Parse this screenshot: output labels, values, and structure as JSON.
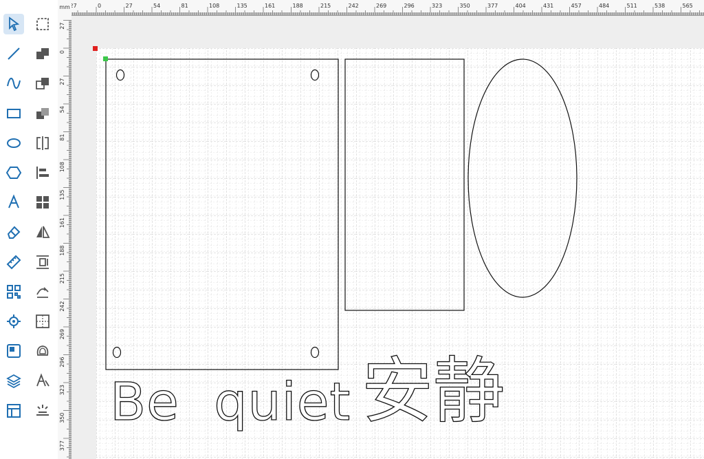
{
  "app": {
    "unit": "mm",
    "accent_color": "#1f6fb2",
    "handle_red": "#e0201e",
    "handle_green": "#3cc84a"
  },
  "tools_left": [
    {
      "name": "select-tool-icon",
      "active": true
    },
    {
      "name": "line-tool-icon"
    },
    {
      "name": "curve-tool-icon"
    },
    {
      "name": "rectangle-tool-icon"
    },
    {
      "name": "ellipse-tool-icon"
    },
    {
      "name": "polygon-tool-icon"
    },
    {
      "name": "text-tool-icon"
    },
    {
      "name": "eraser-tool-icon"
    },
    {
      "name": "ruler-tool-icon"
    },
    {
      "name": "qr-code-tool-icon"
    },
    {
      "name": "position-tool-icon"
    },
    {
      "name": "image-tool-icon"
    },
    {
      "name": "layers-tool-icon"
    },
    {
      "name": "layout-tool-icon"
    }
  ],
  "tools_right": [
    {
      "name": "rounded-corner-icon"
    },
    {
      "name": "union-icon"
    },
    {
      "name": "subtract-icon"
    },
    {
      "name": "intersect-icon"
    },
    {
      "name": "split-icon"
    },
    {
      "name": "align-icon"
    },
    {
      "name": "distribute-icon"
    },
    {
      "name": "mirror-icon"
    },
    {
      "name": "size-icon"
    },
    {
      "name": "edit-path-icon"
    },
    {
      "name": "array-icon"
    },
    {
      "name": "offset-icon"
    },
    {
      "name": "vectorize-icon"
    },
    {
      "name": "effects-icon"
    }
  ],
  "ruler_top_labels": [
    "27",
    "0",
    "27",
    "54",
    "81",
    "108",
    "135",
    "161",
    "188",
    "215",
    "242",
    "269",
    "296",
    "323",
    "350",
    "377",
    "404",
    "431",
    "457",
    "484",
    "511",
    "538",
    "565"
  ],
  "ruler_left_labels": [
    "27",
    "0",
    "27",
    "54",
    "81",
    "108",
    "135",
    "161",
    "188",
    "215",
    "242",
    "269",
    "296",
    "323",
    "350",
    "377"
  ],
  "canvas_text": {
    "english": "Be  quiet",
    "chinese": "安静"
  }
}
